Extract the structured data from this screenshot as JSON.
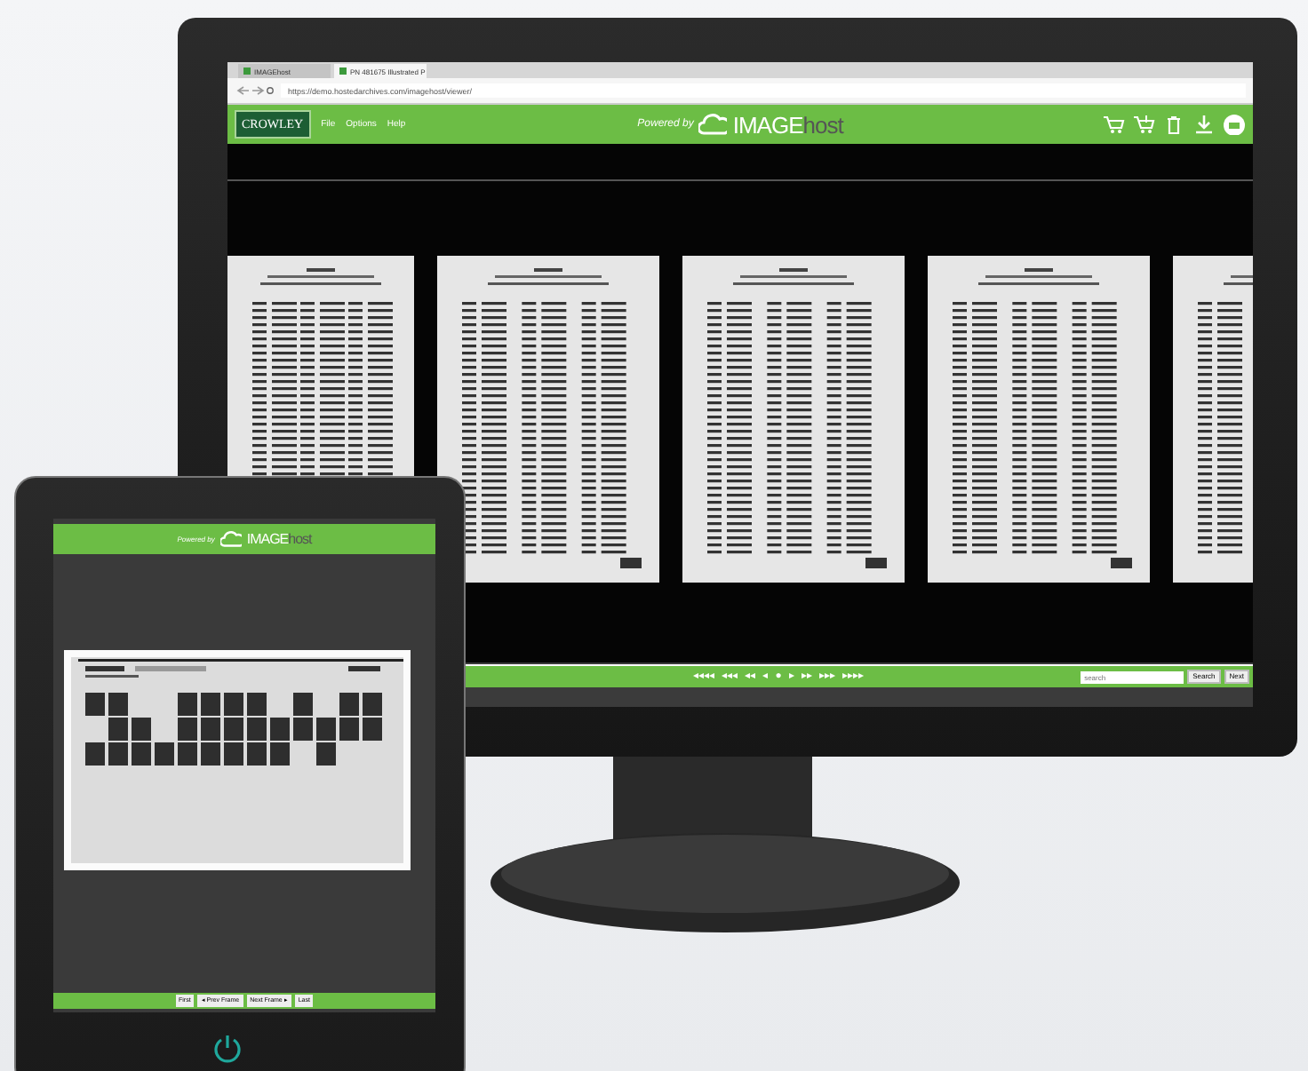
{
  "monitor": {
    "browser": {
      "tabs": [
        {
          "label": "IMAGEhost",
          "selected": false
        },
        {
          "label": "PN 481675 Illustrated P",
          "selected": true
        }
      ],
      "url": "https://demo.hostedarchives.com/imagehost/viewer/"
    },
    "header": {
      "logo": "CROWLEY",
      "menu": [
        "File",
        "Options",
        "Help"
      ],
      "powered_by": "Powered by",
      "brand_main": "IMAGE",
      "brand_suffix": "host"
    },
    "pager": {
      "controls": [
        "◂◂◂◂",
        "◂◂◂",
        "◂◂",
        "◂",
        "●",
        "▸",
        "▸▸",
        "▸▸▸",
        "▸▸▸▸"
      ]
    },
    "search": {
      "placeholder": "search"
    },
    "buttons": [
      "Search",
      "Next"
    ]
  },
  "tablet": {
    "header": {
      "powered_by": "Powered by",
      "brand_main": "IMAGE",
      "brand_suffix": "host"
    },
    "buttons": [
      "First",
      "◂ Prev Frame",
      "Next Frame ▸",
      "Last"
    ]
  }
}
